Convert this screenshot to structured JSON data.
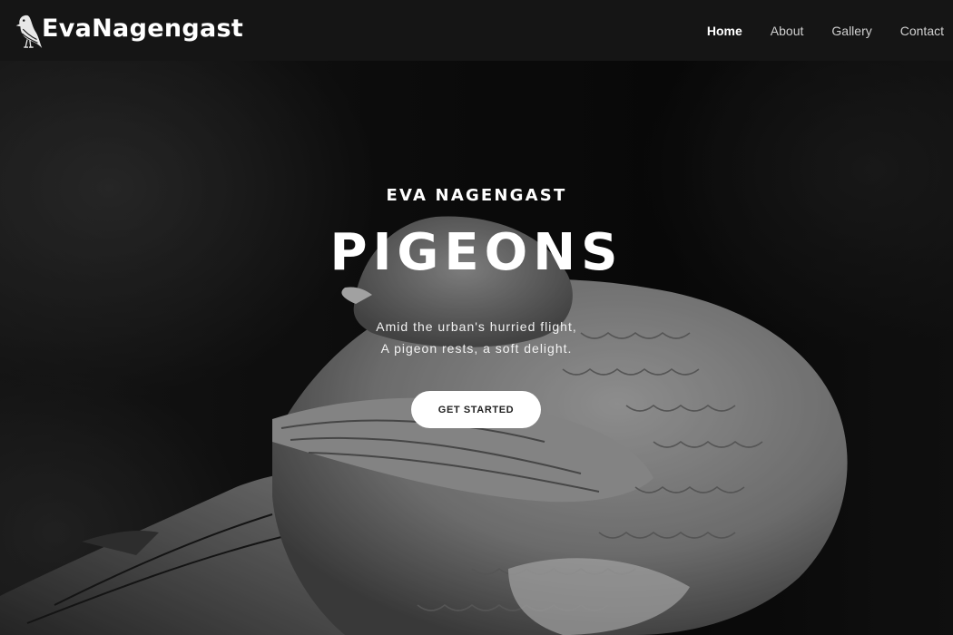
{
  "brand": {
    "name": "EvaNagengast",
    "logo_icon": "pigeon-logo-icon"
  },
  "nav": {
    "items": [
      {
        "label": "Home",
        "active": true
      },
      {
        "label": "About",
        "active": false
      },
      {
        "label": "Gallery",
        "active": false
      },
      {
        "label": "Contact",
        "active": false
      }
    ]
  },
  "hero": {
    "kicker": "EVA NAGENGAST",
    "title": "PIGEONS",
    "text_lines": [
      "Amid the urban's hurried flight,",
      "A pigeon rests, a soft delight."
    ],
    "cta_label": "GET STARTED"
  },
  "colors": {
    "navbar": "#151515",
    "accent": "#ffffff",
    "button_text": "#222222"
  }
}
